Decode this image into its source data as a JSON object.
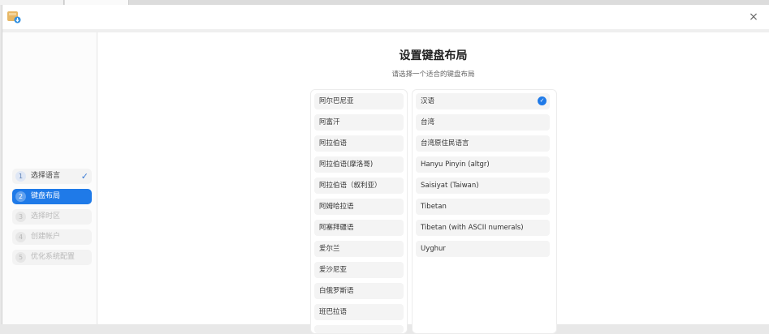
{
  "window": {
    "close_glyph": "×",
    "app_icon": "installer-app-icon"
  },
  "steps": [
    {
      "num": "1",
      "label": "选择语言",
      "state": "done",
      "check": "✓"
    },
    {
      "num": "2",
      "label": "键盘布局",
      "state": "active"
    },
    {
      "num": "3",
      "label": "选择时区",
      "state": "pending"
    },
    {
      "num": "4",
      "label": "创建帐户",
      "state": "pending"
    },
    {
      "num": "5",
      "label": "优化系统配置",
      "state": "pending"
    }
  ],
  "main": {
    "title": "设置键盘布局",
    "subtitle": "请选择一个适合的键盘布局"
  },
  "languages": [
    "阿尔巴尼亚",
    "阿富汗",
    "阿拉伯语",
    "阿拉伯语(摩洛哥)",
    "阿拉伯语（叙利亚）",
    "阿姆哈拉语",
    "阿塞拜疆语",
    "爱尔兰",
    "爱沙尼亚",
    "白俄罗斯语",
    "班巴拉语"
  ],
  "variants": [
    "汉语",
    "台湾",
    "台湾原住民语言",
    "Hanyu Pinyin (altgr)",
    "Saisiyat (Taiwan)",
    "Tibetan",
    "Tibetan (with ASCII numerals)",
    "Uyghur"
  ],
  "selected_variant_check": "✓",
  "colors": {
    "accent": "#1f7ae8"
  }
}
